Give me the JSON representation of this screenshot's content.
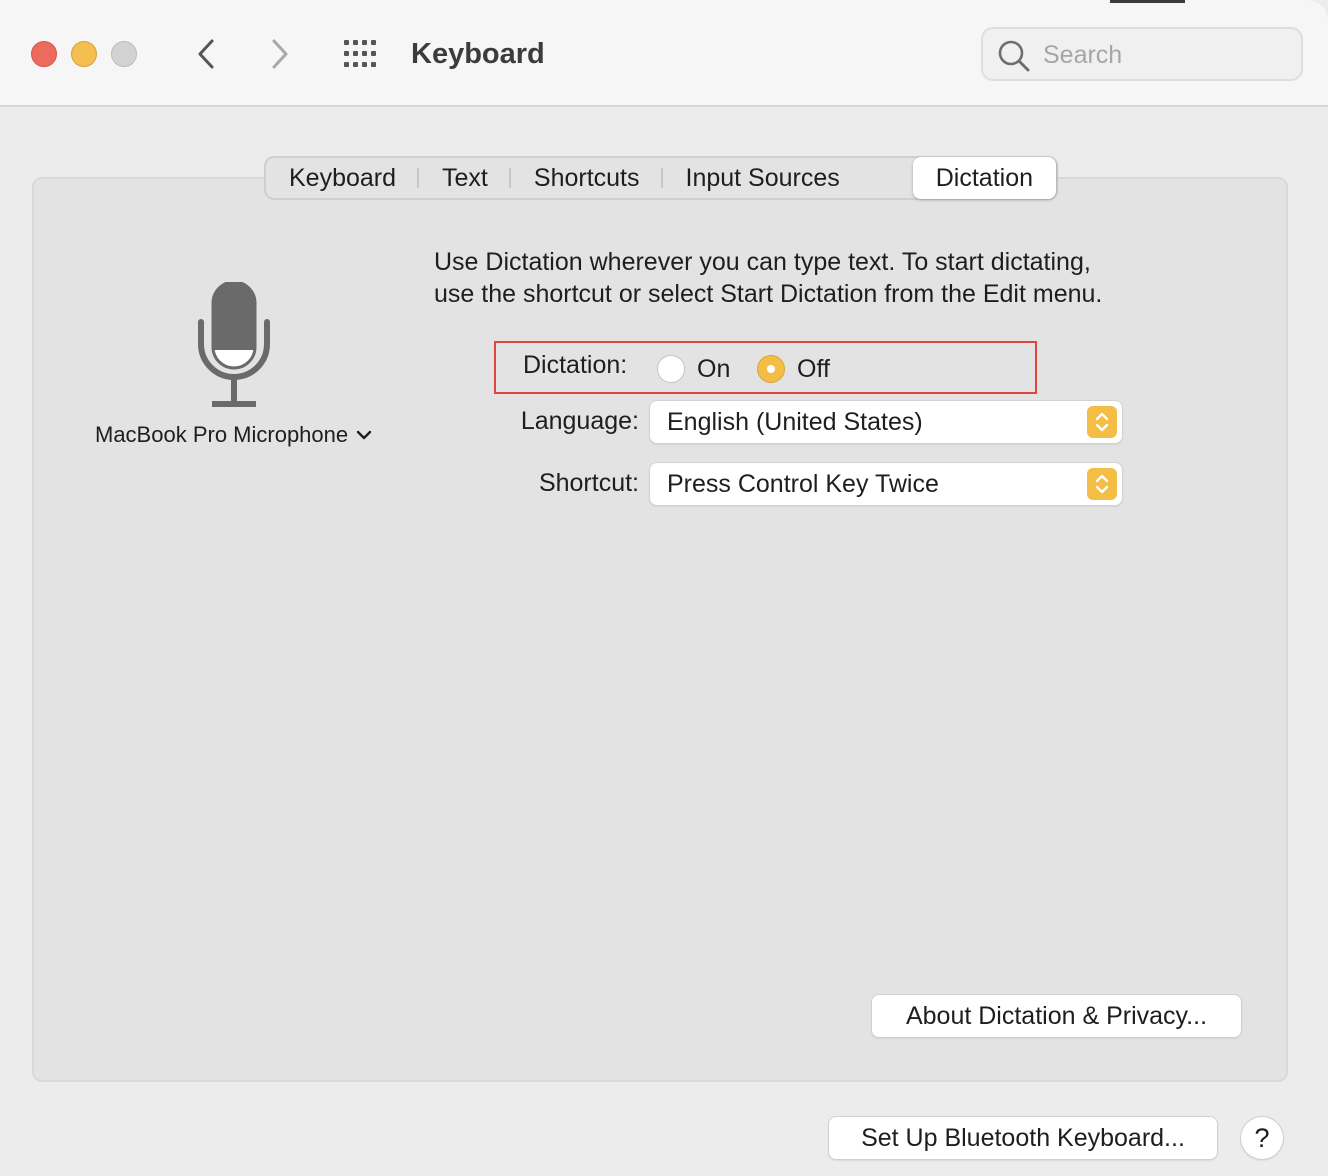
{
  "window": {
    "title": "Keyboard",
    "search_placeholder": "Search"
  },
  "tabs": [
    {
      "label": "Keyboard",
      "selected": false
    },
    {
      "label": "Text",
      "selected": false
    },
    {
      "label": "Shortcuts",
      "selected": false
    },
    {
      "label": "Input Sources",
      "selected": false
    },
    {
      "label": "Dictation",
      "selected": true
    }
  ],
  "microphone": {
    "icon": "microphone-icon",
    "source_label": "MacBook Pro Microphone"
  },
  "description": {
    "line1": "Use Dictation wherever you can type text. To start dictating,",
    "line2": "use the shortcut or select Start Dictation from the Edit menu."
  },
  "dictation": {
    "label": "Dictation:",
    "on_label": "On",
    "off_label": "Off",
    "selected": "Off"
  },
  "language": {
    "label": "Language:",
    "value": "English (United States)"
  },
  "shortcut": {
    "label": "Shortcut:",
    "value": "Press Control Key Twice"
  },
  "buttons": {
    "about": "About Dictation & Privacy...",
    "bluetooth": "Set Up Bluetooth Keyboard...",
    "help": "?"
  },
  "colors": {
    "accent": "#f3bd46",
    "highlight_border": "#e0463b"
  }
}
